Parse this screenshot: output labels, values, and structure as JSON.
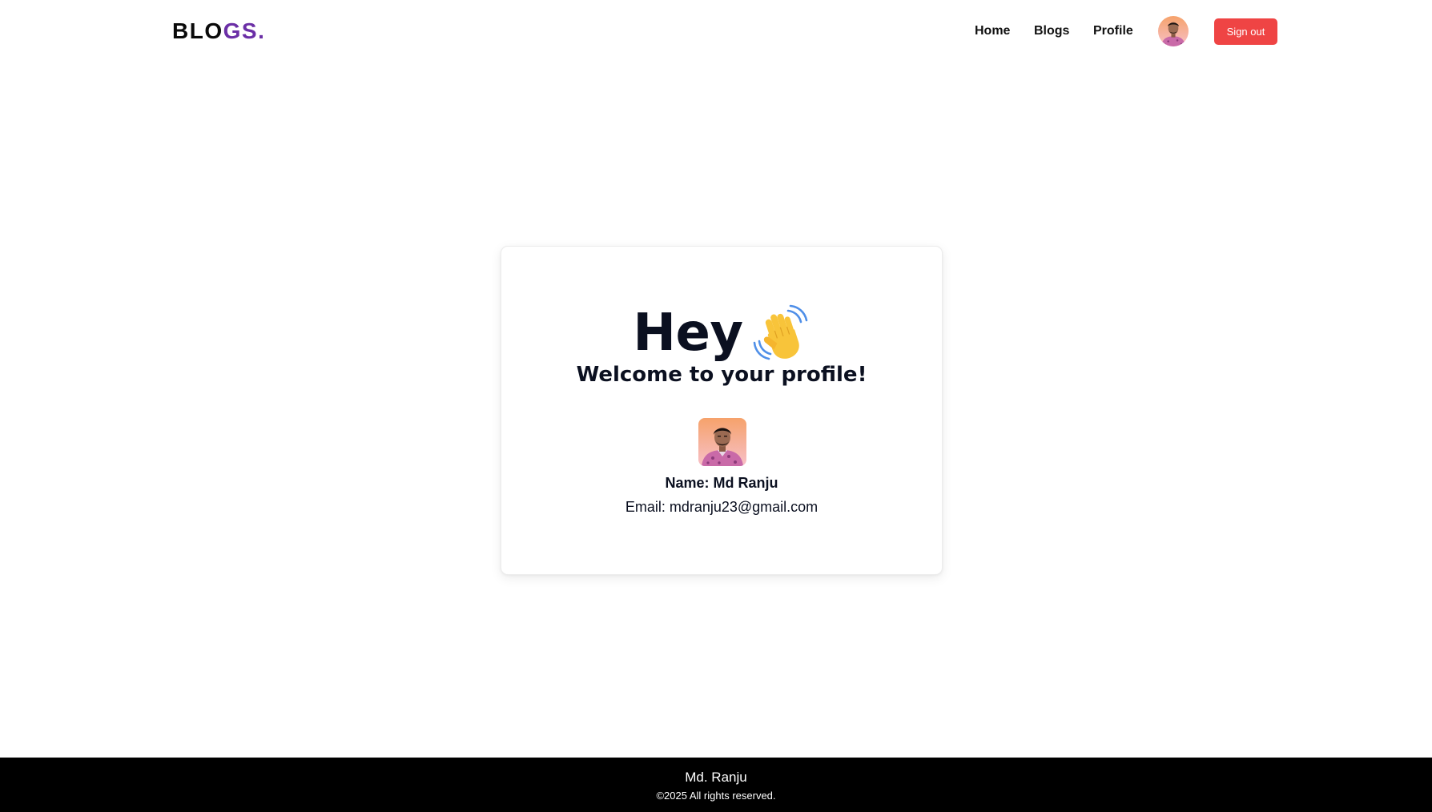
{
  "header": {
    "logo_main": "BLO",
    "logo_accent": "GS.",
    "nav": {
      "home": "Home",
      "blogs": "Blogs",
      "profile": "Profile"
    },
    "signout_label": "Sign out"
  },
  "profile": {
    "greeting": "Hey",
    "greeting_icon": "waving-hand-icon",
    "welcome": "Welcome to your profile!",
    "name_line": "Name: Md Ranju",
    "email_line": "Email: mdranju23@gmail.com"
  },
  "footer": {
    "name": "Md. Ranju",
    "copyright": "©2025 All rights reserved."
  },
  "colors": {
    "accent_purple": "#6b2fa6",
    "signout_red": "#ef4444",
    "text_dark": "#0b1020",
    "footer_bg": "#000000"
  }
}
